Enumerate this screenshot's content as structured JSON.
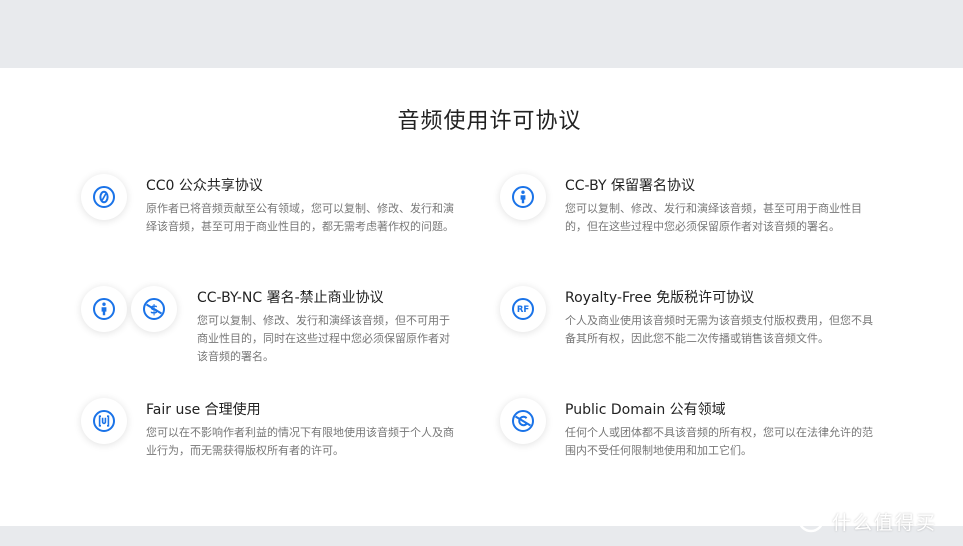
{
  "page": {
    "title": "音频使用许可协议"
  },
  "licenses": [
    {
      "title": "CC0 公众共享协议",
      "desc": "原作者已将音频贡献至公有领域，您可以复制、修改、发行和演绎该音频，甚至可用于商业性目的，都无需考虑著作权的问题。",
      "icons": [
        "cc-zero-icon"
      ]
    },
    {
      "title": "CC-BY 保留署名协议",
      "desc": "您可以复制、修改、发行和演绎该音频，甚至可用于商业性目的，但在这些过程中您必须保留原作者对该音频的署名。",
      "icons": [
        "attribution-icon"
      ]
    },
    {
      "title": "CC-BY-NC 署名-禁止商业协议",
      "desc": "您可以复制、修改、发行和演绎该音频，但不可用于商业性目的，同时在这些过程中您必须保留原作者对该音频的署名。",
      "icons": [
        "attribution-icon",
        "non-commercial-icon"
      ]
    },
    {
      "title": "Royalty-Free 免版税许可协议",
      "desc": "个人及商业使用该音频时无需为该音频支付版权费用，但您不具备其所有权，因此您不能二次传播或销售该音频文件。",
      "icons": [
        "royalty-free-icon"
      ],
      "icon_text": "RF"
    },
    {
      "title": "Fair use 合理使用",
      "desc": "您可以在不影响作者利益的情况下有限地使用该音频于个人及商业行为，而无需获得版权所有者的许可。",
      "icons": [
        "fair-use-icon"
      ]
    },
    {
      "title": "Public Domain 公有领域",
      "desc": "任何个人或团体都不具该音频的所有权，您可以在法律允许的范围内不受任何限制地使用和加工它们。",
      "icons": [
        "public-domain-icon"
      ]
    }
  ],
  "watermark": {
    "text": "什么值得买",
    "icon": "smzdm-logo-icon"
  },
  "colors": {
    "accent": "#1a73e8",
    "title": "#222222",
    "desc": "#777777",
    "band": "#e8eaed"
  }
}
